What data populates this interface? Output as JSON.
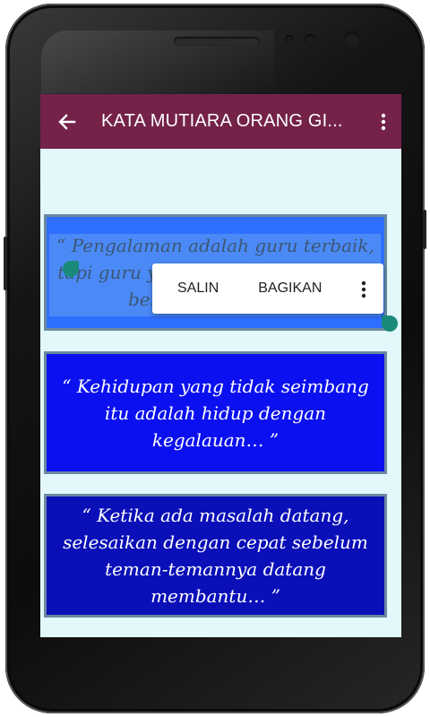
{
  "app_bar": {
    "title": "KATA MUTIARA ORANG GI...",
    "back_icon": "arrow-left-icon",
    "overflow_icon": "more-vertical-icon",
    "color": "#74224a"
  },
  "context_menu": {
    "copy_label": "SALIN",
    "share_label": "BAGIKAN",
    "more_icon": "more-vertical-icon"
  },
  "quotes": [
    {
      "text": "“ Pengalaman adalah guru terbaik, tapi guru yang baik belum tentu ia berpengalaman… ”",
      "selected": true,
      "color": "#2f6fff"
    },
    {
      "text": "“ Kehidupan yang tidak seimbang itu adalah hidup dengan kegalauan… ”",
      "selected": false,
      "color": "#0b10f0"
    },
    {
      "text": "“ Ketika ada masalah datang, selesaikan dengan cepat sebelum teman-temannya datang membantu… ”",
      "selected": false,
      "color": "#0a0fb8"
    }
  ],
  "colors": {
    "content_background": "#e2f8fb",
    "selection_handle": "#1a8a7a"
  }
}
